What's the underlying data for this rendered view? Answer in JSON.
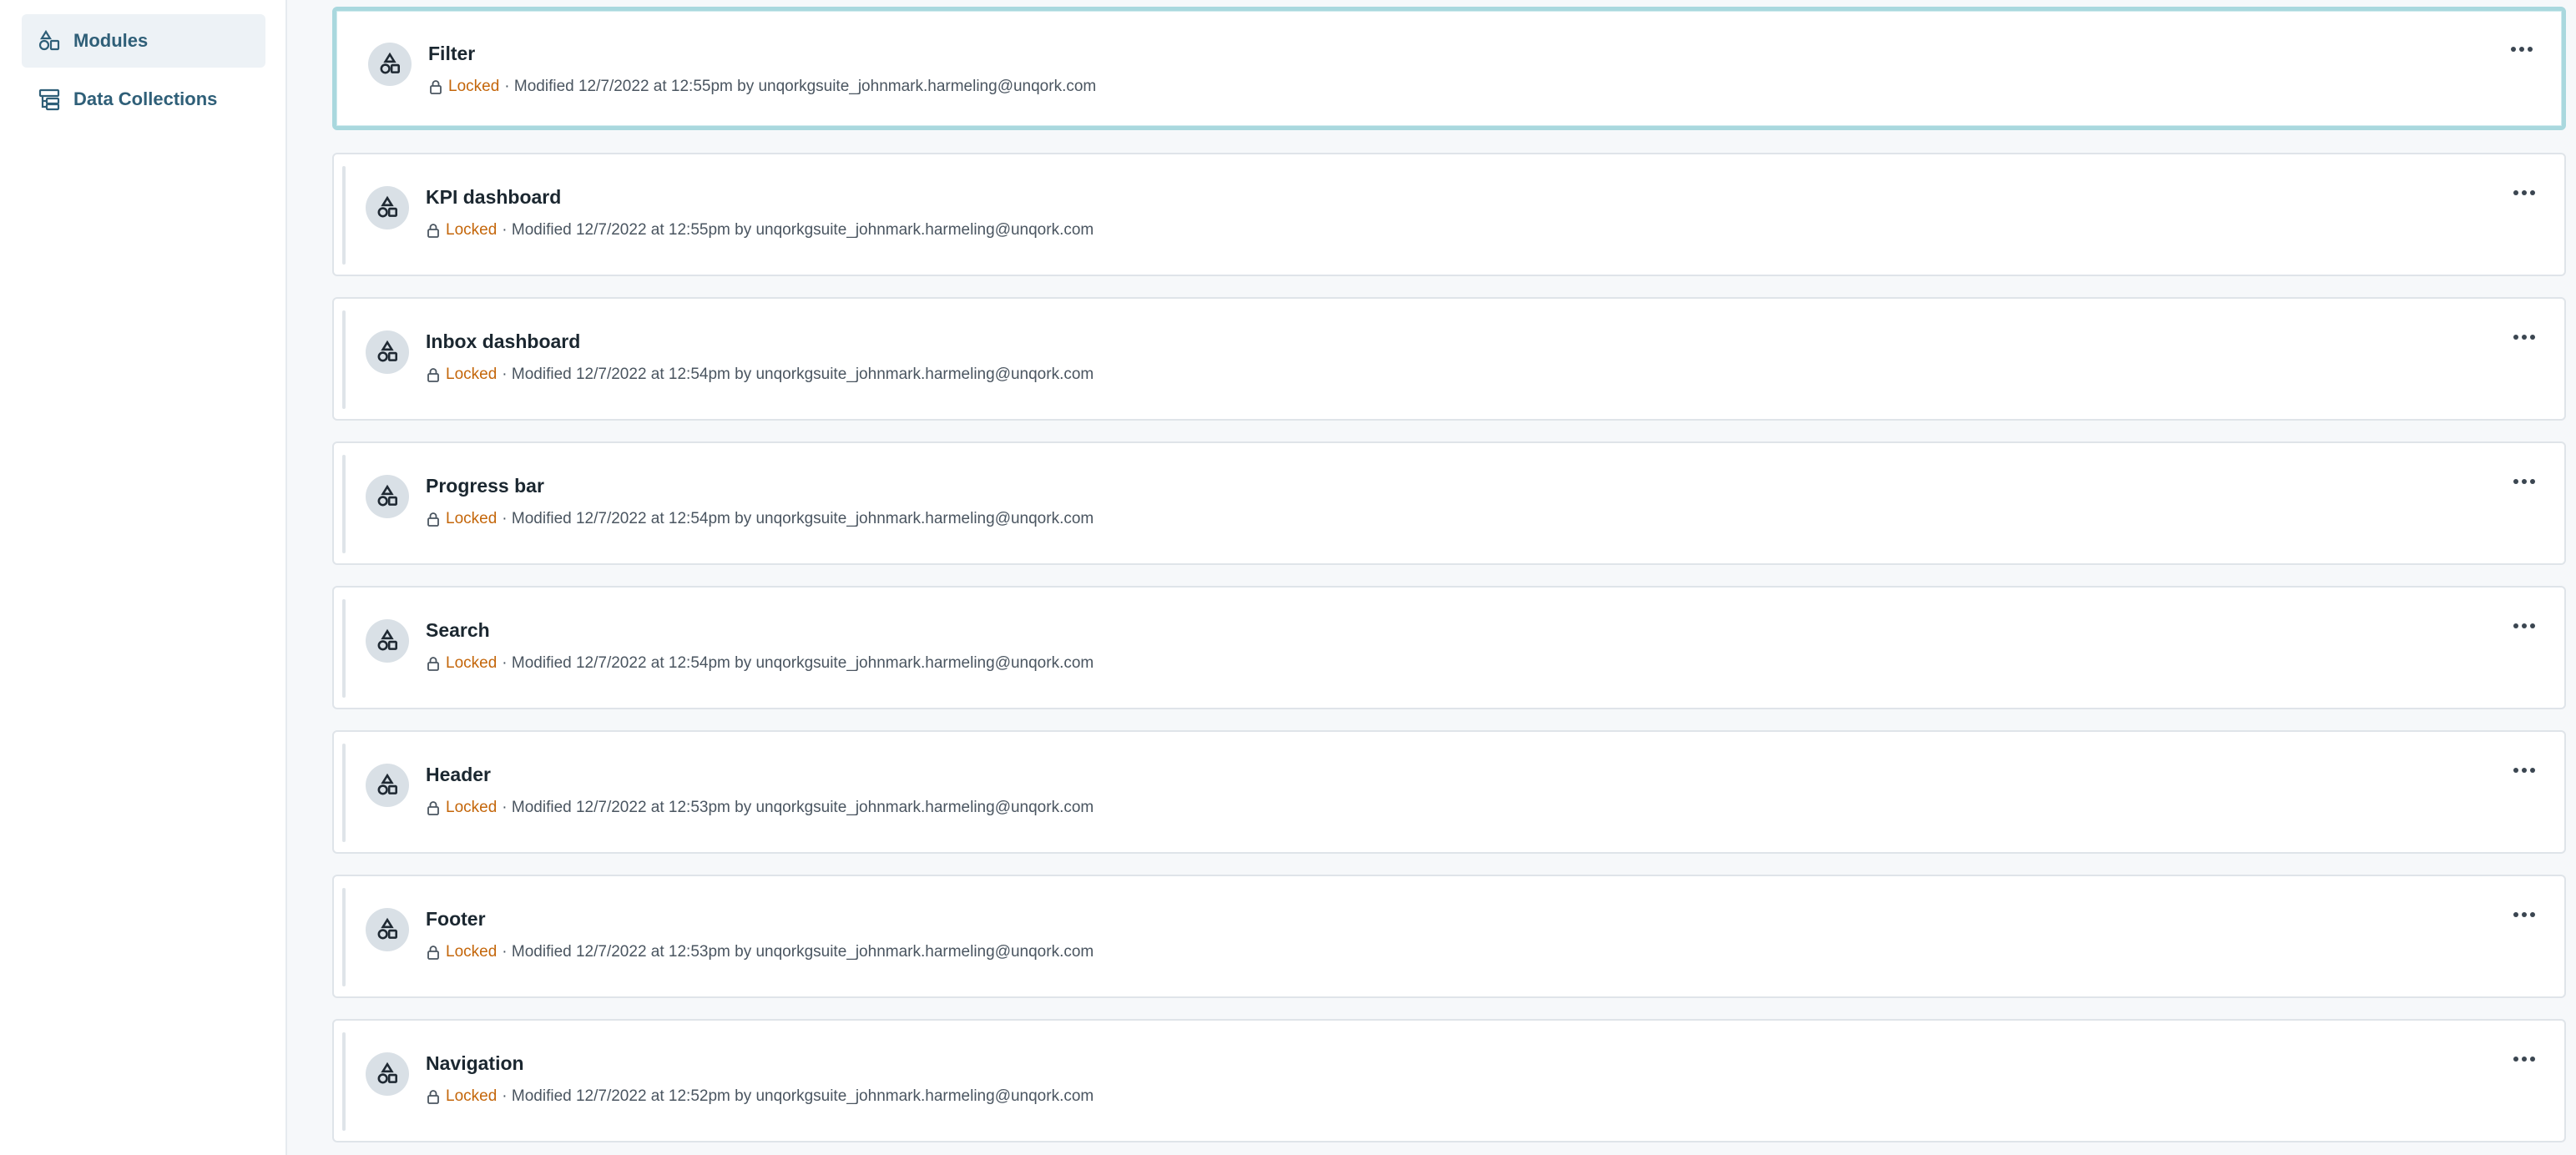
{
  "sidebar": {
    "items": [
      {
        "label": "Modules",
        "icon": "modules-icon",
        "active": true
      },
      {
        "label": "Data Collections",
        "icon": "data-collections-icon",
        "active": false
      }
    ]
  },
  "modules": [
    {
      "title": "Filter",
      "status": "Locked",
      "meta": "· Modified 12/7/2022 at 12:55pm by unqorkgsuite_johnmark.harmeling@unqork.com",
      "selected": true
    },
    {
      "title": "KPI dashboard",
      "status": "Locked",
      "meta": "· Modified 12/7/2022 at 12:55pm by unqorkgsuite_johnmark.harmeling@unqork.com"
    },
    {
      "title": "Inbox dashboard",
      "status": "Locked",
      "meta": "· Modified 12/7/2022 at 12:54pm by unqorkgsuite_johnmark.harmeling@unqork.com"
    },
    {
      "title": "Progress bar",
      "status": "Locked",
      "meta": "· Modified 12/7/2022 at 12:54pm by unqorkgsuite_johnmark.harmeling@unqork.com"
    },
    {
      "title": "Search",
      "status": "Locked",
      "meta": "· Modified 12/7/2022 at 12:54pm by unqorkgsuite_johnmark.harmeling@unqork.com"
    },
    {
      "title": "Header",
      "status": "Locked",
      "meta": "· Modified 12/7/2022 at 12:53pm by unqorkgsuite_johnmark.harmeling@unqork.com"
    },
    {
      "title": "Footer",
      "status": "Locked",
      "meta": "· Modified 12/7/2022 at 12:53pm by unqorkgsuite_johnmark.harmeling@unqork.com"
    },
    {
      "title": "Navigation",
      "status": "Locked",
      "meta": "· Modified 12/7/2022 at 12:52pm by unqorkgsuite_johnmark.harmeling@unqork.com"
    }
  ],
  "colors": {
    "locked": "#c4660a",
    "accent": "#2f5f78",
    "selected_border": "#a9d8de"
  }
}
